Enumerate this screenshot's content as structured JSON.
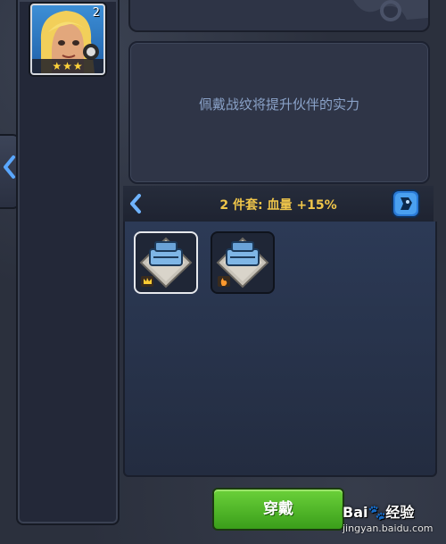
{
  "hero": {
    "level": "2",
    "stars": "★★★"
  },
  "info": {
    "message": "佩戴战纹将提升伙伴的实力"
  },
  "set_bonus": {
    "label": "2 件套: 血量 +15%"
  },
  "slots": [
    {
      "selected": true,
      "badge_icon": "crown-badge-icon"
    },
    {
      "selected": false,
      "badge_icon": "flame-badge-icon"
    }
  ],
  "actions": {
    "equip_label": "穿戴"
  },
  "watermark": {
    "logo": "Bai🐾经验",
    "site": "jingyan.baidu.com"
  },
  "colors": {
    "accent_gold": "#f0c64a",
    "info_text": "#8aa2c8",
    "equip_green": "#4fb827"
  }
}
